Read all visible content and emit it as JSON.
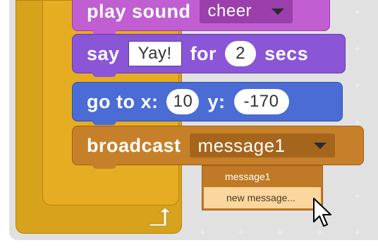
{
  "blocks": {
    "play_sound": {
      "label": "play sound",
      "sound_value": "cheer"
    },
    "say": {
      "label": "say",
      "text_value": "Yay!",
      "for_label": "for",
      "secs_value": "2",
      "secs_label": "secs"
    },
    "goto": {
      "label": "go to x:",
      "x_value": "10",
      "y_label": "y:",
      "y_value": "-170"
    },
    "broadcast": {
      "label": "broadcast",
      "message_value": "message1"
    }
  },
  "dropdown_menu": {
    "items": [
      {
        "label": "message1",
        "highlighted": false
      },
      {
        "label": "new message...",
        "highlighted": true
      }
    ]
  },
  "colors": {
    "sound_block": "#c15ed2",
    "looks_block": "#8a55d7",
    "motion_block": "#4a6cd4",
    "events_block": "#c7802a",
    "control_block": "#e6ad22",
    "menu_highlight": "#fbd79f"
  },
  "icons": [
    "loop-arrow-icon",
    "dropdown-caret-icon",
    "mouse-pointer-icon"
  ]
}
